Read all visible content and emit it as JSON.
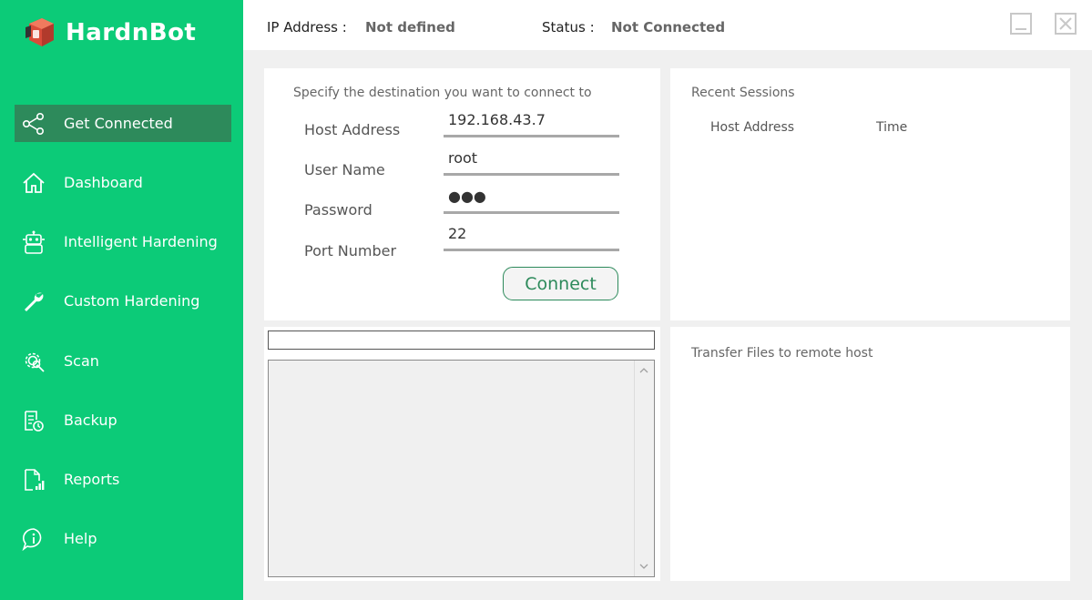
{
  "app": {
    "name": "HardnBot"
  },
  "sidebar": {
    "items": [
      {
        "label": "Get Connected",
        "icon": "share-nodes-icon"
      },
      {
        "label": "Dashboard",
        "icon": "home-icon"
      },
      {
        "label": "Intelligent Hardening",
        "icon": "robot-icon"
      },
      {
        "label": "Custom Hardening",
        "icon": "wrench-icon"
      },
      {
        "label": "Scan",
        "icon": "gear-scan-icon"
      },
      {
        "label": "Backup",
        "icon": "backup-icon"
      },
      {
        "label": "Reports",
        "icon": "report-chart-icon"
      },
      {
        "label": "Help",
        "icon": "info-icon"
      }
    ],
    "active_index": 0
  },
  "header": {
    "ip_label": "IP Address :",
    "ip_value": "Not defined",
    "status_label": "Status :",
    "status_value": "Not Connected"
  },
  "connect_panel": {
    "title": "Specify the destination you want to connect to",
    "host_label": "Host Address",
    "host_value": "192.168.43.7",
    "user_label": "User Name",
    "user_value": "root",
    "password_label": "Password",
    "password_value": "●●●",
    "port_label": "Port Number",
    "port_value": "22",
    "connect_button": "Connect"
  },
  "recent_sessions": {
    "title": "Recent Sessions",
    "columns": [
      "Host Address",
      "Time"
    ]
  },
  "transfer_panel": {
    "title": "Transfer Files to remote host"
  },
  "colors": {
    "sidebar_bg": "#0ccb78",
    "active_item_bg": "#2d8a5b",
    "background": "#f0f0f0"
  }
}
